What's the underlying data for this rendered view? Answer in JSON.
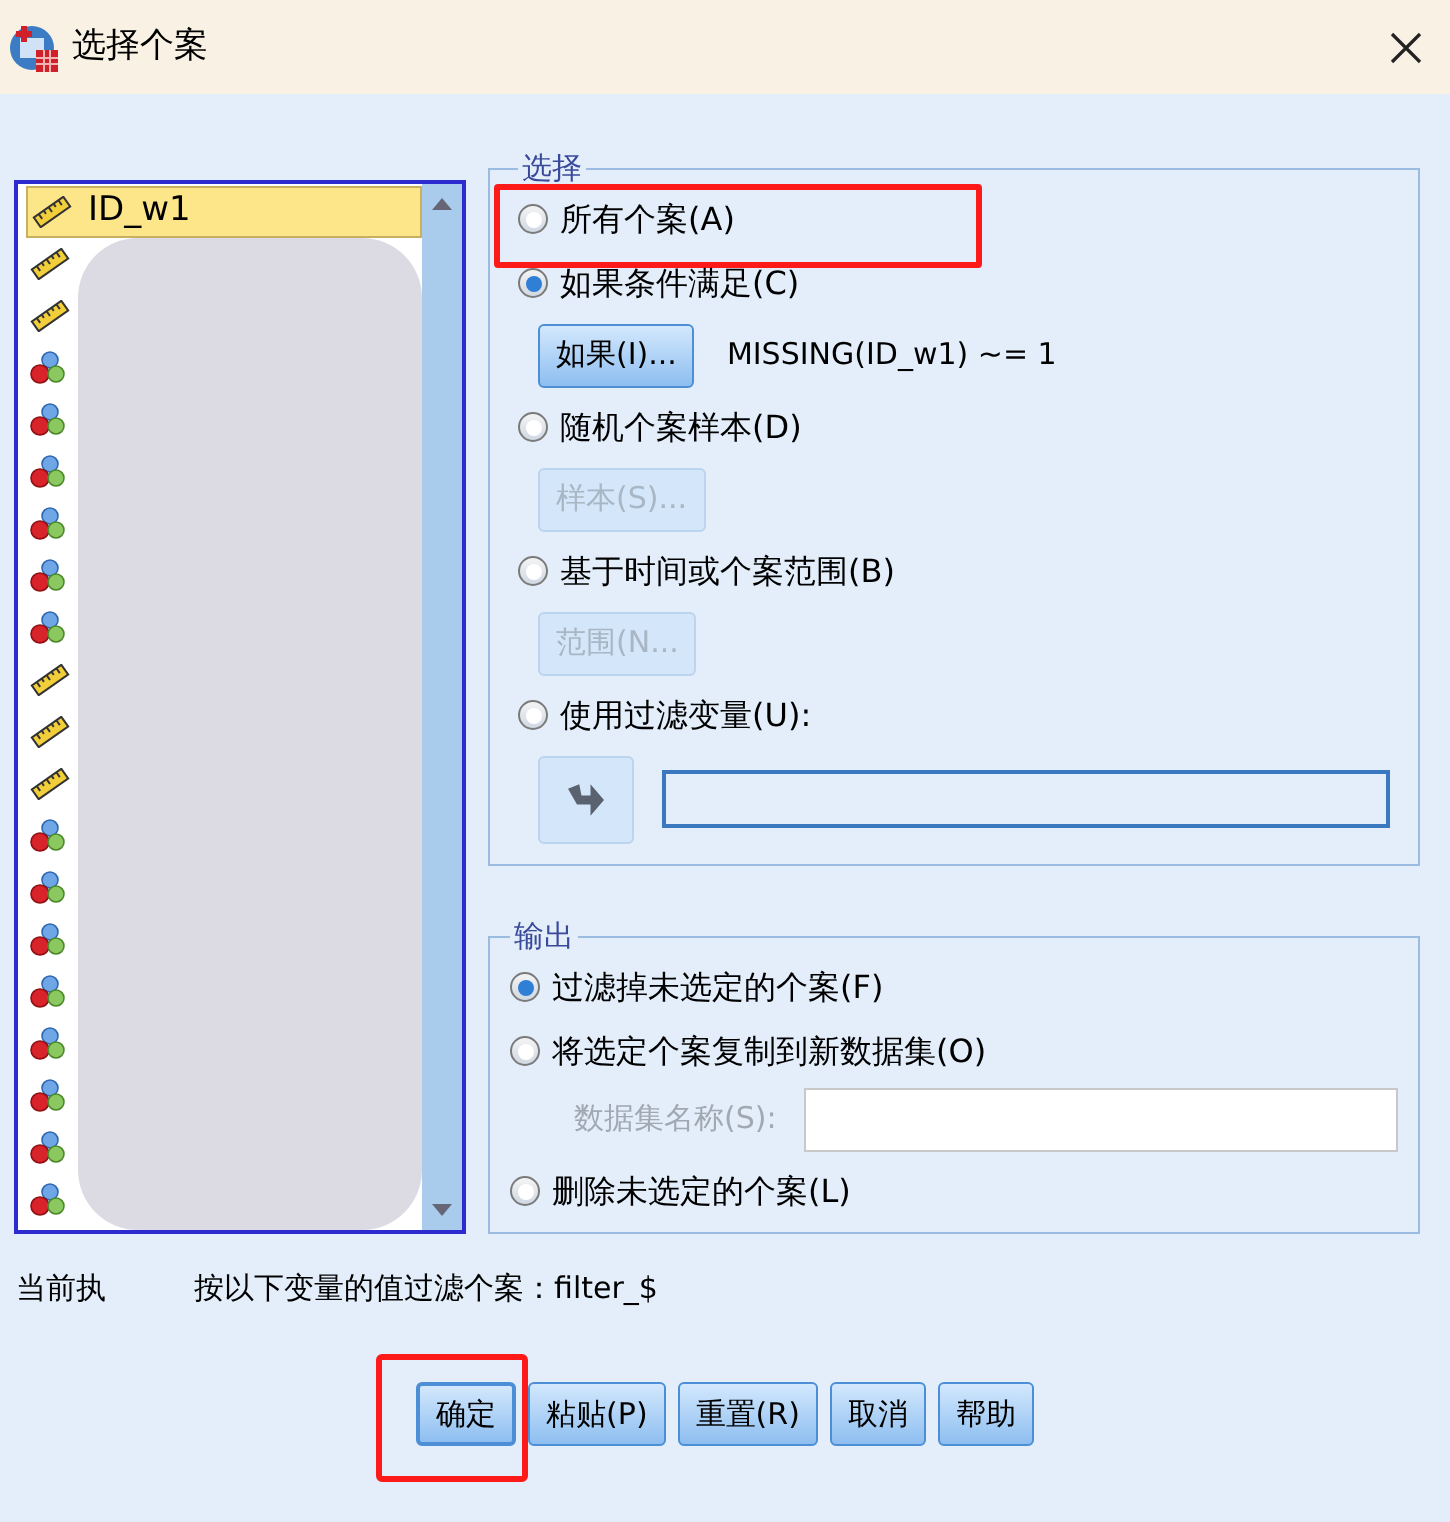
{
  "window": {
    "title": "选择个案"
  },
  "variables": [
    {
      "label": "ID_w1",
      "kind": "scale",
      "selected": true
    },
    {
      "kind": "scale",
      "selected": false
    },
    {
      "kind": "scale",
      "selected": false
    },
    {
      "kind": "nominal",
      "selected": false
    },
    {
      "kind": "nominal",
      "selected": false
    },
    {
      "kind": "nominal",
      "selected": false
    },
    {
      "kind": "nominal",
      "selected": false
    },
    {
      "kind": "nominal",
      "selected": false
    },
    {
      "kind": "nominal",
      "selected": false
    },
    {
      "kind": "scale",
      "selected": false
    },
    {
      "kind": "scale",
      "selected": false
    },
    {
      "kind": "scale",
      "selected": false
    },
    {
      "kind": "nominal",
      "selected": false
    },
    {
      "kind": "nominal",
      "selected": false
    },
    {
      "kind": "nominal",
      "selected": false
    },
    {
      "kind": "nominal",
      "selected": false
    },
    {
      "kind": "nominal",
      "selected": false
    },
    {
      "kind": "nominal",
      "selected": false
    },
    {
      "kind": "nominal",
      "selected": false
    },
    {
      "kind": "nominal",
      "selected": false
    }
  ],
  "select_group": {
    "title": "选择",
    "options": [
      {
        "label": "所有个案(A)",
        "selected": false,
        "highlighted": true
      },
      {
        "label": "如果条件满足(C)",
        "selected": true,
        "highlighted": false,
        "button": {
          "label": "如果(I)...",
          "disabled": false
        },
        "expression": "MISSING(ID_w1) ~= 1"
      },
      {
        "label": "随机个案样本(D)",
        "selected": false,
        "highlighted": false,
        "button": {
          "label": "样本(S)...",
          "disabled": true
        }
      },
      {
        "label": "基于时间或个案范围(B)",
        "selected": false,
        "highlighted": false,
        "button": {
          "label": "范围(N...",
          "disabled": true
        }
      },
      {
        "label": "使用过滤变量(U):",
        "selected": false,
        "highlighted": false,
        "kind": "filter_variable"
      }
    ]
  },
  "output_group": {
    "title": "输出",
    "options": [
      {
        "label": "过滤掉未选定的个案(F)",
        "selected": true
      },
      {
        "label": "将选定个案复制到新数据集(O)",
        "selected": false,
        "dataset_name": {
          "label": "数据集名称(S):",
          "disabled": true
        }
      },
      {
        "label": "删除未选定的个案(L)",
        "selected": false
      }
    ]
  },
  "status": {
    "visible_start": "当前执",
    "visible_end": "按以下变量的值过滤个案：filter_$"
  },
  "buttons": [
    {
      "label": "确定",
      "default": true,
      "highlighted": true
    },
    {
      "label": "粘贴(P)",
      "default": false,
      "highlighted": false
    },
    {
      "label": "重置(R)",
      "default": false,
      "highlighted": false
    },
    {
      "label": "取消",
      "default": false,
      "highlighted": false
    },
    {
      "label": "帮助",
      "default": false,
      "highlighted": false
    }
  ]
}
